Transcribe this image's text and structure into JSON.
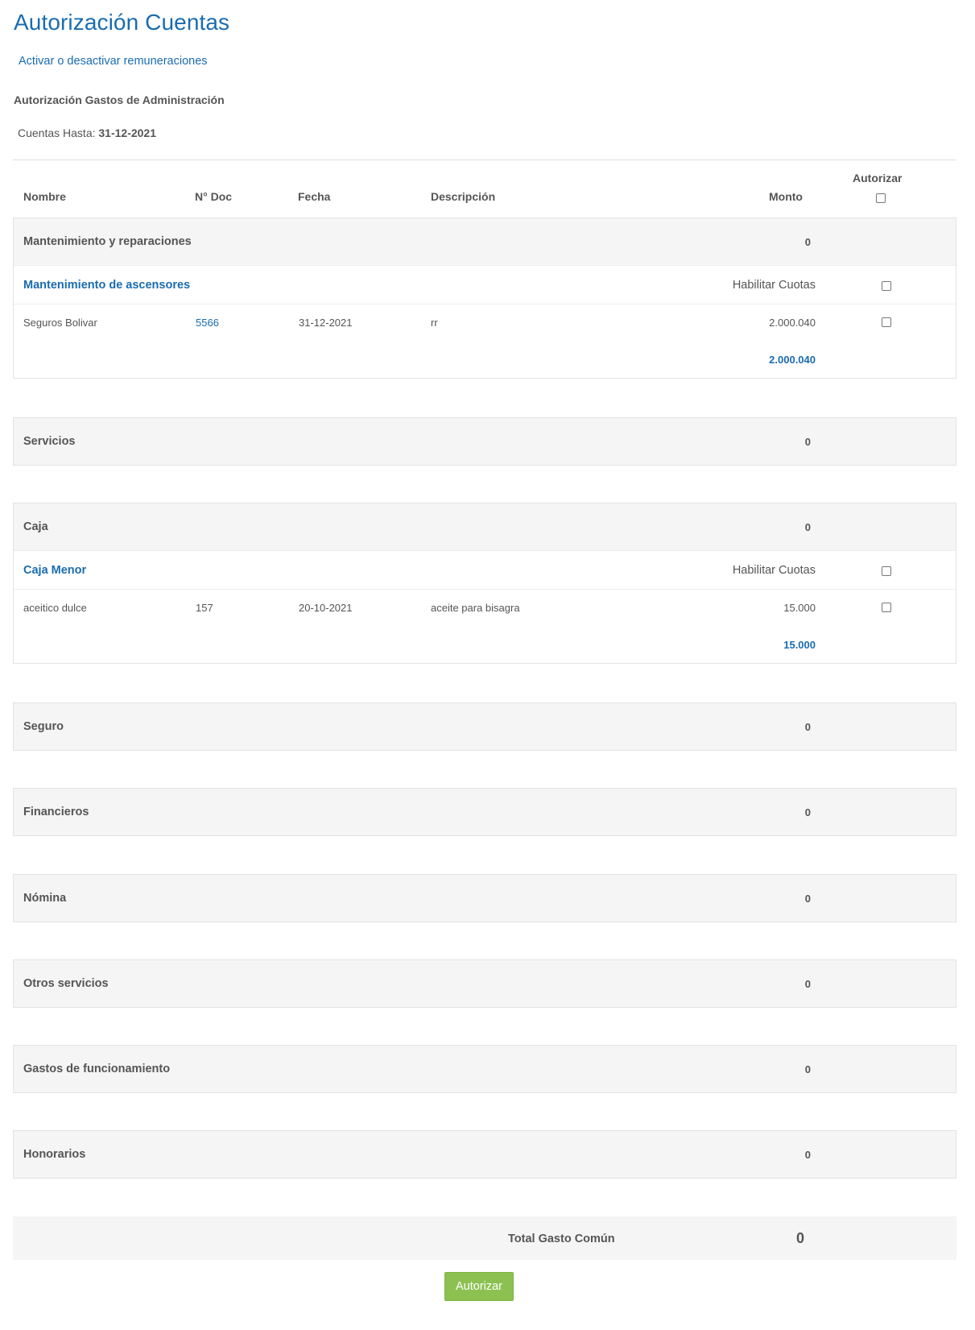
{
  "page": {
    "title": "Autorización Cuentas",
    "toggle_link": "Activar o desactivar remuneraciones",
    "section_title": "Autorización Gastos de Administración",
    "cuentas_hasta_label": "Cuentas Hasta:",
    "cuentas_hasta_value": "31-12-2021"
  },
  "table": {
    "headers": {
      "nombre": "Nombre",
      "doc": "N° Doc",
      "fecha": "Fecha",
      "descripcion": "Descripción",
      "monto": "Monto",
      "autorizar": "Autorizar"
    }
  },
  "groups": [
    {
      "name": "Mantenimiento y reparaciones",
      "total": "0",
      "subgroups": [
        {
          "name": "Mantenimiento de ascensores",
          "habilitar_label": "Habilitar Cuotas",
          "items": [
            {
              "nombre": "Seguros Bolivar",
              "doc": "5566",
              "fecha": "31-12-2021",
              "descripcion": "rr",
              "monto": "2.000.040"
            }
          ],
          "subtotal": "2.000.040"
        }
      ]
    },
    {
      "name": "Servicios",
      "total": "0"
    },
    {
      "name": "Caja",
      "total": "0",
      "subgroups": [
        {
          "name": "Caja Menor",
          "habilitar_label": "Habilitar Cuotas",
          "items": [
            {
              "nombre": "aceitico dulce",
              "doc": "157",
              "fecha": "20-10-2021",
              "descripcion": "aceite para bisagra",
              "monto": "15.000"
            }
          ],
          "subtotal": "15.000"
        }
      ]
    },
    {
      "name": "Seguro",
      "total": "0"
    },
    {
      "name": "Financieros",
      "total": "0"
    },
    {
      "name": "Nómina",
      "total": "0"
    },
    {
      "name": "Otros servicios",
      "total": "0"
    },
    {
      "name": "Gastos de funcionamiento",
      "total": "0"
    },
    {
      "name": "Honorarios",
      "total": "0"
    }
  ],
  "footer": {
    "total_label": "Total Gasto Común",
    "total_value": "0",
    "submit_label": "Autorizar"
  }
}
